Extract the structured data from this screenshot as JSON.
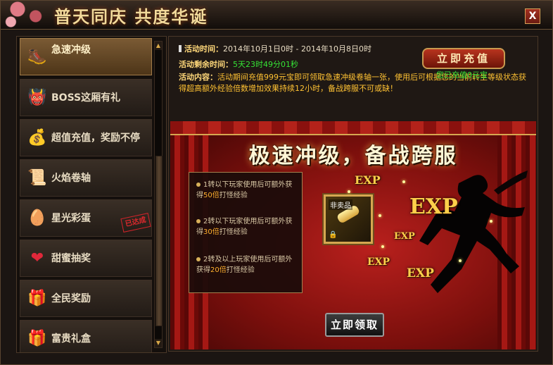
{
  "title_bar": {
    "title": "普天同庆 共度华诞",
    "close_label": "X"
  },
  "sidebar": {
    "items": [
      {
        "label": "急速冲级",
        "icon": "boot-icon",
        "glyph": "🥾",
        "active": true
      },
      {
        "label": "BOSS这厢有礼",
        "icon": "demon-mask-icon",
        "glyph": "👹"
      },
      {
        "label": "超值充值，奖励不停",
        "icon": "gift-bag-icon",
        "glyph": "💰"
      },
      {
        "label": "火焰卷轴",
        "icon": "scroll-icon",
        "glyph": "📜"
      },
      {
        "label": "星光彩蛋",
        "icon": "egg-icon",
        "glyph": "🥚",
        "stamp": "已达成"
      },
      {
        "label": "甜蜜抽奖",
        "icon": "heart-icon",
        "glyph": "❤"
      },
      {
        "label": "全民奖励",
        "icon": "present-icon",
        "glyph": "🎁"
      },
      {
        "label": "富贵礼盒",
        "icon": "gift-box-icon",
        "glyph": "🎁"
      }
    ],
    "scroll_up": "▲",
    "scroll_down": "▼"
  },
  "activity": {
    "time_label": "活动时间：",
    "time_value": "2014年10月1日0时 - 2014年10月8日0时",
    "remaining_label": "活动剩余时间：",
    "remaining_value": "5天23时49分01秒",
    "content_label": "活动内容：",
    "content_value": "活动期间充值999元宝即可领取急速冲级卷轴一张，使用后可根据您的当前转生等级状态获得超高额外经验倍数增加效果持续12小时，备战跨服不可或缺！",
    "recharge_button": "立即充值",
    "recharged_text": "您已充值0元宝"
  },
  "banner": {
    "headline": "极速冲级，备战跨服",
    "rules": [
      {
        "pre": "1转以下玩家使用后可额外获得",
        "mult": "50倍",
        "post": "打怪经验"
      },
      {
        "pre": "2转以下玩家使用后可额外获得",
        "mult": "30倍",
        "post": "打怪经验"
      },
      {
        "pre": "2转及以上玩家使用后可额外获得",
        "mult": "20倍",
        "post": "打怪经验"
      }
    ],
    "item_label": "非卖品",
    "exp_text": "EXP",
    "claim_button": "立即领取"
  },
  "colors": {
    "accent_gold": "#d6a750",
    "highlight_green": "#35e335",
    "curtain_red": "#a51814"
  }
}
